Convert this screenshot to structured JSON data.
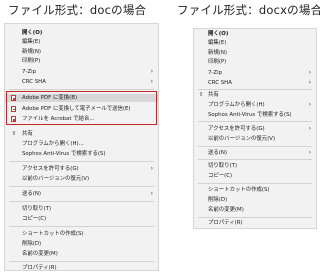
{
  "titles": {
    "left": "ファイル形式：docの場合",
    "right": "ファイル形式：docxの場合"
  },
  "colors": {
    "highlight_box": "#c62828",
    "menu_bg": "#f2f2f2",
    "pdf_icon": "#c0392b"
  },
  "left_menu": {
    "items": [
      {
        "label": "開く(O)",
        "bold": true
      },
      {
        "label": "編集(E)"
      },
      {
        "label": "新規(N)"
      },
      {
        "label": "印刷(P)"
      },
      {
        "label": "7-Zip",
        "submenu": true
      },
      {
        "label": "CRC SHA",
        "submenu": true
      },
      {
        "label": "Adobe PDF に変換(B)",
        "icon": "pdf-icon",
        "highlighted": true
      },
      {
        "label": "Adobe PDF に変換して電子メールで送信(E)",
        "icon": "pdf-icon"
      },
      {
        "label": "ファイルを Acrobat で結合...",
        "icon": "pdf-icon"
      },
      {
        "label": "共有",
        "icon": "share-icon"
      },
      {
        "label": "プログラムから開く(H)..."
      },
      {
        "label": "Sophos Anti-Virus で検索する(S)"
      },
      {
        "label": "アクセスを許可する(G)",
        "submenu": true
      },
      {
        "label": "以前のバージョンの復元(V)"
      },
      {
        "label": "送る(N)",
        "submenu": true
      },
      {
        "label": "切り取り(T)"
      },
      {
        "label": "コピー(C)"
      },
      {
        "label": "ショートカットの作成(S)"
      },
      {
        "label": "削除(D)"
      },
      {
        "label": "名前の変更(M)"
      },
      {
        "label": "プロパティ(R)"
      }
    ]
  },
  "right_menu": {
    "items": [
      {
        "label": "開く(O)",
        "bold": true
      },
      {
        "label": "編集(E)"
      },
      {
        "label": "新規(N)"
      },
      {
        "label": "印刷(P)"
      },
      {
        "label": "7-Zip",
        "submenu": true
      },
      {
        "label": "CRC SHA",
        "submenu": true
      },
      {
        "label": "共有",
        "icon": "share-icon"
      },
      {
        "label": "プログラムから開く(H)",
        "submenu": true
      },
      {
        "label": "Sophos Anti-Virus で検索する(S)"
      },
      {
        "label": "アクセスを許可する(G)",
        "submenu": true
      },
      {
        "label": "以前のバージョンの復元(V)"
      },
      {
        "label": "送る(N)",
        "submenu": true
      },
      {
        "label": "切り取り(T)"
      },
      {
        "label": "コピー(C)"
      },
      {
        "label": "ショートカットの作成(S)"
      },
      {
        "label": "削除(D)"
      },
      {
        "label": "名前の変更(M)"
      },
      {
        "label": "プロパティ(R)"
      }
    ]
  }
}
